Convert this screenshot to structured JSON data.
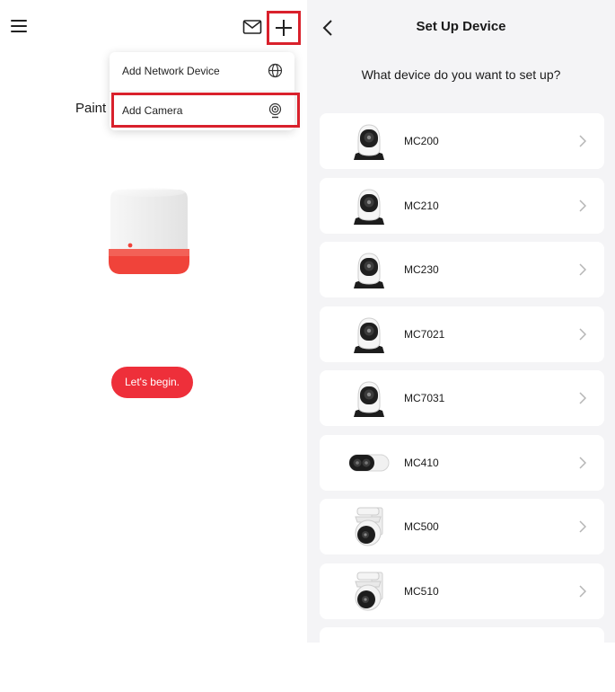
{
  "left_panel": {
    "paint_label": "Paint",
    "add_menu": {
      "items": [
        {
          "label": "Add Network Device",
          "icon": "globe-icon"
        },
        {
          "label": "Add Camera",
          "icon": "camera-icon"
        }
      ]
    },
    "begin_button": "Let's begin."
  },
  "right_panel": {
    "title": "Set Up Device",
    "question": "What device do you want to set up?",
    "devices": [
      {
        "name": "MC200",
        "kind": "pan-tilt"
      },
      {
        "name": "MC210",
        "kind": "pan-tilt"
      },
      {
        "name": "MC230",
        "kind": "pan-tilt"
      },
      {
        "name": "MC7021",
        "kind": "pan-tilt"
      },
      {
        "name": "MC7031",
        "kind": "pan-tilt"
      },
      {
        "name": "MC410",
        "kind": "bullet"
      },
      {
        "name": "MC500",
        "kind": "outdoor-ptz"
      },
      {
        "name": "MC510",
        "kind": "outdoor-ptz"
      },
      {
        "name": "",
        "kind": "partial"
      }
    ]
  },
  "colors": {
    "accent_red": "#ee2f3a",
    "highlight_red": "#d9212c",
    "background_gray": "#f4f4f6"
  }
}
